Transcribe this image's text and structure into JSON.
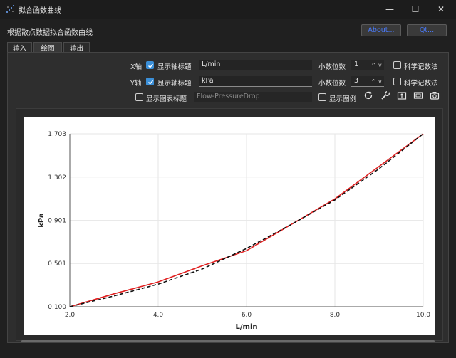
{
  "window": {
    "title": "拟合函数曲线",
    "minimize": "—",
    "maximize": "☐",
    "close": "✕"
  },
  "header": {
    "description": "根据散点数据拟合函数曲线",
    "about_label": "About...",
    "qt_label": "Qt..."
  },
  "tabs": [
    {
      "label": "输入",
      "active": false
    },
    {
      "label": "绘图",
      "active": true
    },
    {
      "label": "输出",
      "active": false
    }
  ],
  "settings": {
    "x_axis": {
      "label": "X轴",
      "show_title_label": "显示轴标题",
      "show_title_checked": true,
      "title_value": "L/min",
      "decimals_label": "小数位数",
      "decimals_value": "1",
      "sci_label": "科学记数法",
      "sci_checked": false
    },
    "y_axis": {
      "label": "Y轴",
      "show_title_label": "显示轴标题",
      "show_title_checked": true,
      "title_value": "kPa",
      "decimals_label": "小数位数",
      "decimals_value": "3",
      "sci_label": "科学记数法",
      "sci_checked": false
    },
    "chart_title": {
      "show_label": "显示图表标题",
      "checked": false,
      "value": "Flow-PressureDrop"
    },
    "legend": {
      "label": "显示图例",
      "checked": false
    },
    "spin_up": "^",
    "spin_down": "v"
  },
  "toolbar_icons": [
    "refresh-icon",
    "wrench-icon",
    "export-icon",
    "fit-view-icon",
    "camera-icon"
  ],
  "chart_data": {
    "type": "line",
    "xlabel": "L/min",
    "ylabel": "kPa",
    "xlim": [
      2.0,
      10.0
    ],
    "ylim": [
      0.1,
      1.703
    ],
    "xticks": [
      "2.0",
      "4.0",
      "6.0",
      "8.0",
      "10.0"
    ],
    "yticks": [
      "0.100",
      "0.501",
      "0.901",
      "1.302",
      "1.703"
    ],
    "grid": true,
    "series": [
      {
        "color": "#e02020",
        "style": "solid",
        "x": [
          2.0,
          3.0,
          4.0,
          5.0,
          6.0,
          7.0,
          8.0,
          9.0,
          10.0
        ],
        "y": [
          0.1,
          0.22,
          0.33,
          0.48,
          0.62,
          0.86,
          1.1,
          1.4,
          1.703
        ]
      },
      {
        "color": "#111111",
        "style": "dashed",
        "x": [
          2.0,
          3.0,
          4.0,
          5.0,
          6.0,
          7.0,
          8.0,
          9.0,
          10.0
        ],
        "y": [
          0.1,
          0.2,
          0.31,
          0.45,
          0.64,
          0.86,
          1.09,
          1.38,
          1.703
        ]
      }
    ]
  }
}
